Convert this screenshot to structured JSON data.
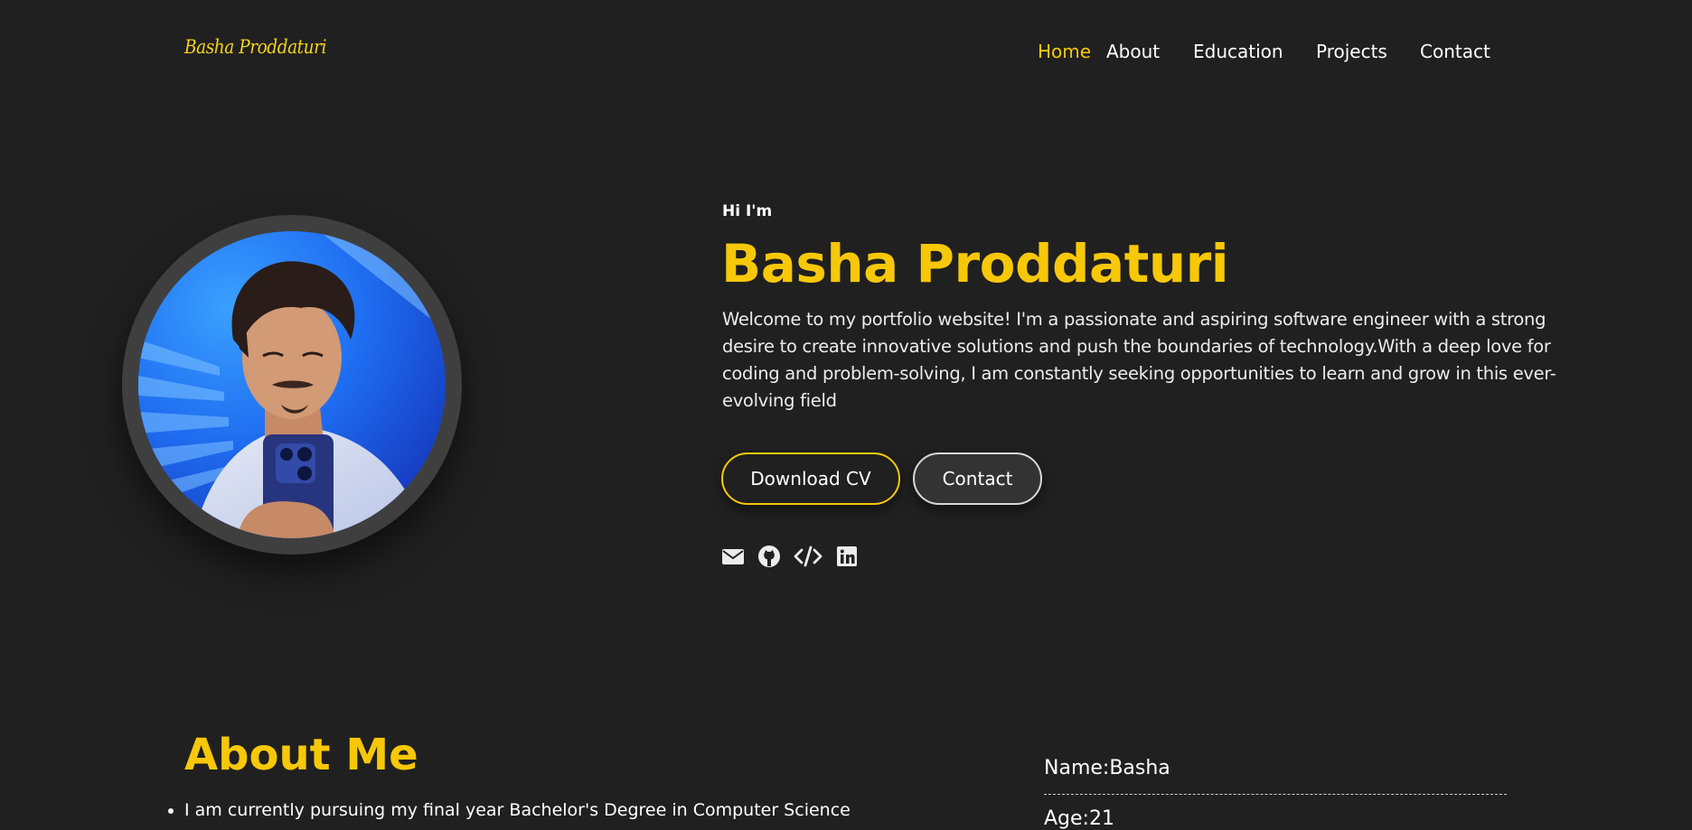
{
  "header": {
    "logo": "Basha Proddaturi",
    "nav": [
      {
        "label": "Home",
        "active": true
      },
      {
        "label": "About",
        "active": false
      },
      {
        "label": "Education",
        "active": false
      },
      {
        "label": "Projects",
        "active": false
      },
      {
        "label": "Contact",
        "active": false
      }
    ]
  },
  "hero": {
    "greeting": "Hi I'm",
    "name": "Basha Proddaturi",
    "intro": "Welcome to my portfolio website! I'm a passionate and aspiring software engineer with a strong desire to create innovative solutions and push the boundaries of technology.With a deep love for coding and problem-solving, I am constantly seeking opportunities to learn and grow in this ever-evolving field",
    "buttons": {
      "download_cv": "Download CV",
      "contact": "Contact"
    },
    "social_icons": [
      "envelope-icon",
      "github-icon",
      "code-icon",
      "linkedin-icon"
    ]
  },
  "about": {
    "title": "About Me",
    "first_item": "I am currently pursuing my final year Bachelor's Degree in Computer Science",
    "info": {
      "name": "Name:Basha",
      "age": "Age:21"
    }
  },
  "colors": {
    "background": "#202020",
    "accent": "#f7c808",
    "text": "#ffffff",
    "button_dark": "#333333"
  }
}
